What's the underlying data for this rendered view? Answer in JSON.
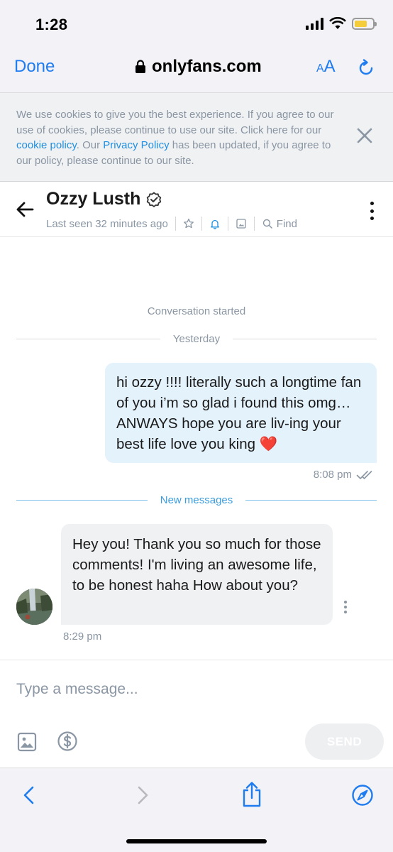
{
  "status_bar": {
    "time": "1:28",
    "battery_level": 0.7
  },
  "browser": {
    "done_label": "Done",
    "url": "onlyfans.com",
    "text_size_label_small": "A",
    "text_size_label_large": "A"
  },
  "cookie_banner": {
    "text_1": "We use cookies to give you the best experience. If you agree to our use of cookies, please continue to use our site. Click here for our ",
    "cookie_link": "cookie policy",
    "text_2": ". Our ",
    "privacy_link": "Privacy Policy",
    "text_3": " has been updated, if you agree to our policy, please continue to our site."
  },
  "chat_header": {
    "name": "Ozzy Lusth",
    "last_seen": "Last seen 32 minutes ago",
    "find_label": "Find"
  },
  "conversation": {
    "started_label": "Conversation started",
    "yesterday_label": "Yesterday",
    "new_messages_label": "New messages",
    "outgoing": {
      "text": "hi ozzy !!!! literally such a longtime fan of you i’m so glad i found this omg… ANWAYS hope you are liv-ing your best life love you king ❤️",
      "time": "8:08 pm"
    },
    "incoming": {
      "text": "Hey you! Thank you so much for those comments! I'm living an awesome life, to be honest haha How about you?",
      "time": "8:29 pm"
    }
  },
  "composer": {
    "placeholder": "Type a message...",
    "send_label": "SEND"
  },
  "colors": {
    "accent": "#1e7bf0",
    "outgoing_bubble": "#e4f2fc",
    "incoming_bubble": "#f0f1f3",
    "muted_text": "#8a96a3"
  }
}
